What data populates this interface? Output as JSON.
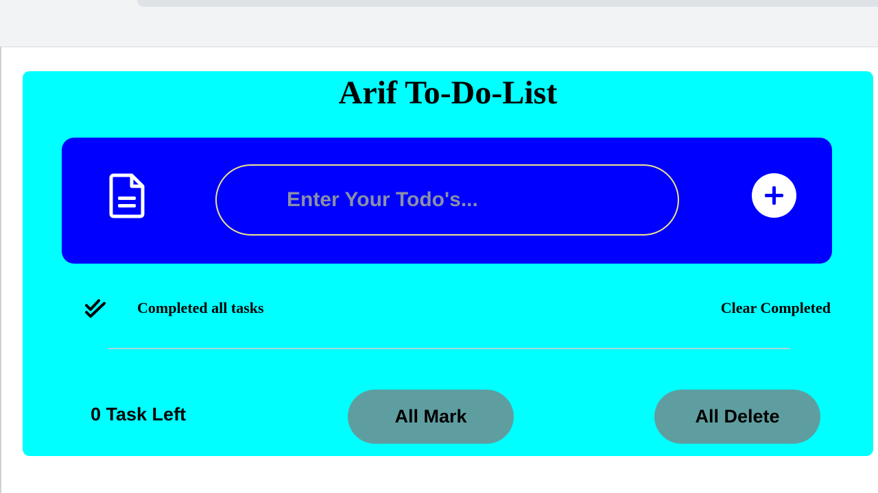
{
  "app": {
    "title": "Arif To-Do-List"
  },
  "input_panel": {
    "placeholder": "Enter Your Todo's...",
    "value": "",
    "doc_icon": "file-lines-icon",
    "add_icon": "plus-circle-icon"
  },
  "controls": {
    "complete_all_icon": "double-check-icon",
    "complete_all_label": "Completed all tasks",
    "clear_completed_label": "Clear Completed"
  },
  "footer": {
    "tasks_left": "0 Task Left",
    "all_mark_label": "All Mark",
    "all_delete_label": "All Delete"
  },
  "colors": {
    "card_background": "#00ffff",
    "panel_background": "#0000ff",
    "input_border": "#f0e68c",
    "pill_button": "#5f9ea0",
    "title_text": "#000000"
  }
}
